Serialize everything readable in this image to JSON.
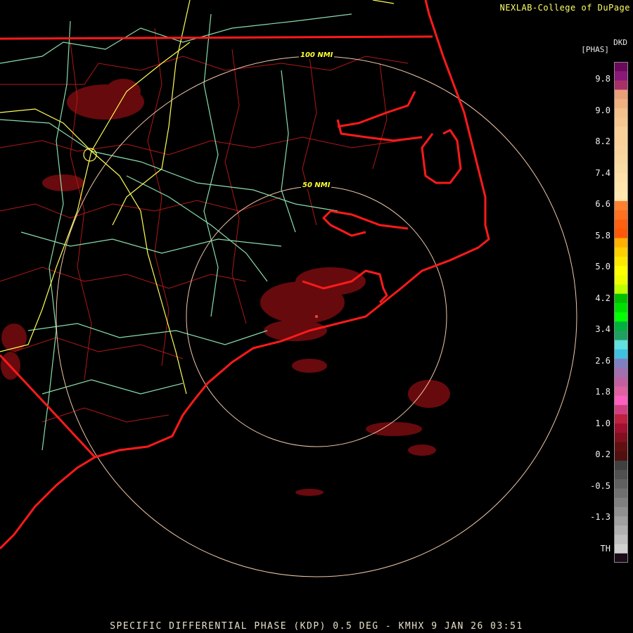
{
  "credit": "NEXLAB-College of DuPage",
  "footer": "SPECIFIC DIFFERENTIAL PHASE (KDP) 0.5 DEG - KMHX 9 JAN 26 03:51",
  "legend": {
    "unit_top": "DKD",
    "unit": "[PHAS]",
    "ticks": [
      "9.8",
      "9.0",
      "8.2",
      "7.4",
      "6.6",
      "5.8",
      "5.0",
      "4.2",
      "3.4",
      "2.6",
      "1.8",
      "1.0",
      "0.2",
      "-0.5",
      "-1.3",
      "TH"
    ],
    "colors": [
      "#6a0a5c",
      "#8a1878",
      "#a83068",
      "#e8a078",
      "#f0b080",
      "#f4c08c",
      "#f6c890",
      "#f8d098",
      "#f8d098",
      "#f8d49c",
      "#f8d8a0",
      "#f8dca4",
      "#ffe0a8",
      "#ffe4ac",
      "#ffe8b0",
      "#ff8030",
      "#ff7020",
      "#ff6010",
      "#ff5808",
      "#ffb000",
      "#ffd000",
      "#ffe800",
      "#ffff00",
      "#f0ff00",
      "#c0ff00",
      "#00c000",
      "#00e000",
      "#00ff00",
      "#00b040",
      "#20a060",
      "#60e0e0",
      "#40c0e0",
      "#8080c0",
      "#a070b0",
      "#c060a0",
      "#e060a0",
      "#ff60c0",
      "#d04080",
      "#c02040",
      "#a01030",
      "#801020",
      "#601010",
      "#501010",
      "#404040",
      "#505050",
      "#606060",
      "#707070",
      "#808080",
      "#909090",
      "#a0a0a0",
      "#b0b0b0",
      "#c0c0c0",
      "#d0d0d0",
      "#1a0a1a"
    ]
  },
  "rings": {
    "inner_label": "50 NMI",
    "outer_label": "100 NMI"
  },
  "colors": {
    "state_border": "#ff1a1a",
    "county_border": "#b01818",
    "highway_primary": "#ffff55",
    "highway_secondary": "#88ddaa",
    "range_ring": "#f0c8a8",
    "echo": "#7a0c10"
  },
  "map_icons": [
    "radar-site-icon",
    "coastline",
    "range-ring",
    "state-border",
    "county-border",
    "highway"
  ]
}
